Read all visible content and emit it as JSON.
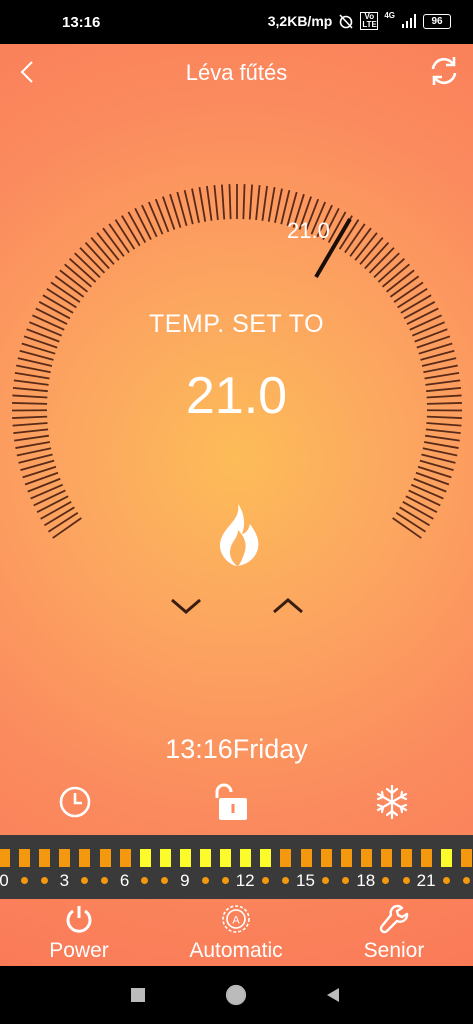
{
  "status_bar": {
    "time": "13:16",
    "net_speed": "3,2KB/mp",
    "volte": "Vo LTE",
    "network": "4G",
    "battery": "96"
  },
  "header": {
    "title": "Léva fűtés",
    "back_icon": "chevron-left-icon",
    "refresh_icon": "refresh-icon"
  },
  "dial": {
    "label": "TEMP. SET TO",
    "set_value": "21.0",
    "marker_value": "21.0",
    "decrease_icon": "chevron-down-icon",
    "increase_icon": "chevron-up-icon",
    "heating_icon": "flame-icon",
    "tick_color": "#5a2a18"
  },
  "clock": {
    "time": "13:16",
    "day": "Friday"
  },
  "mode_icons": {
    "schedule": "clock-icon",
    "lock": "unlock-icon",
    "frost": "snowflake-icon"
  },
  "schedule": {
    "hour_labels": [
      "0",
      "3",
      "6",
      "9",
      "12",
      "15",
      "18",
      "21"
    ],
    "comfort_slots": [
      14,
      15,
      16,
      17,
      18,
      19,
      20,
      29
    ],
    "slot_color": "#f3980f",
    "comfort_color": "#fcfc2c"
  },
  "bottom_nav": {
    "power": "Power",
    "automatic": "Automatic",
    "senior": "Senior"
  },
  "system_nav": {
    "recent": "square-icon",
    "home": "circle-icon",
    "back": "triangle-back-icon"
  }
}
